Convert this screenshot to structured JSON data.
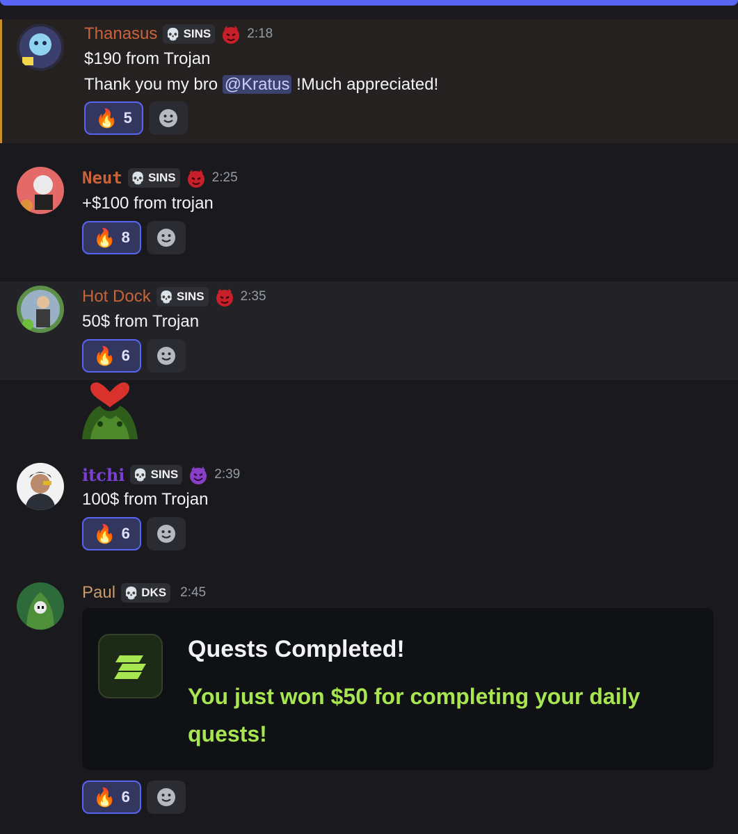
{
  "colors": {
    "accent": "#5865f2",
    "highlight_border": "#c98f2e",
    "embed_green": "#a7e651"
  },
  "messages": [
    {
      "username": "Thanasus",
      "username_color": "#c9633a",
      "tag_icon": "skull-icon",
      "tag": "SINS",
      "role_icon": "red-devil-icon",
      "time": "2:18",
      "line1": "$190 from Trojan",
      "line2_pre": "Thank you my bro ",
      "mention": "@Kratus",
      "line2_post": " !Much appreciated!",
      "reaction_emoji": "fire-icon",
      "reaction_count": "5"
    },
    {
      "username": "Neut",
      "username_color": "#c9633a",
      "tag": "SINS",
      "time": "2:25",
      "line1": "+$100 from trojan",
      "reaction_count": "8"
    },
    {
      "username": "Hot Dock",
      "username_color": "#c9633a",
      "tag": "SINS",
      "time": "2:35",
      "line1": "50$ from Trojan",
      "reaction_count": "6"
    },
    {
      "sticker": "frog-heart-sticker"
    },
    {
      "username": "itchi",
      "username_color": "#7b3fd4",
      "tag": "SINS",
      "role_icon": "purple-devil-icon",
      "time": "2:39",
      "line1": "100$ from Trojan",
      "reaction_count": "6"
    },
    {
      "username": "Paul",
      "username_color": "#c99a6a",
      "tag": "DKS",
      "time": "2:45",
      "embed_title": "Quests Completed!",
      "embed_description": "You just won $50 for completing your daily quests!",
      "reaction_count": "6"
    }
  ]
}
